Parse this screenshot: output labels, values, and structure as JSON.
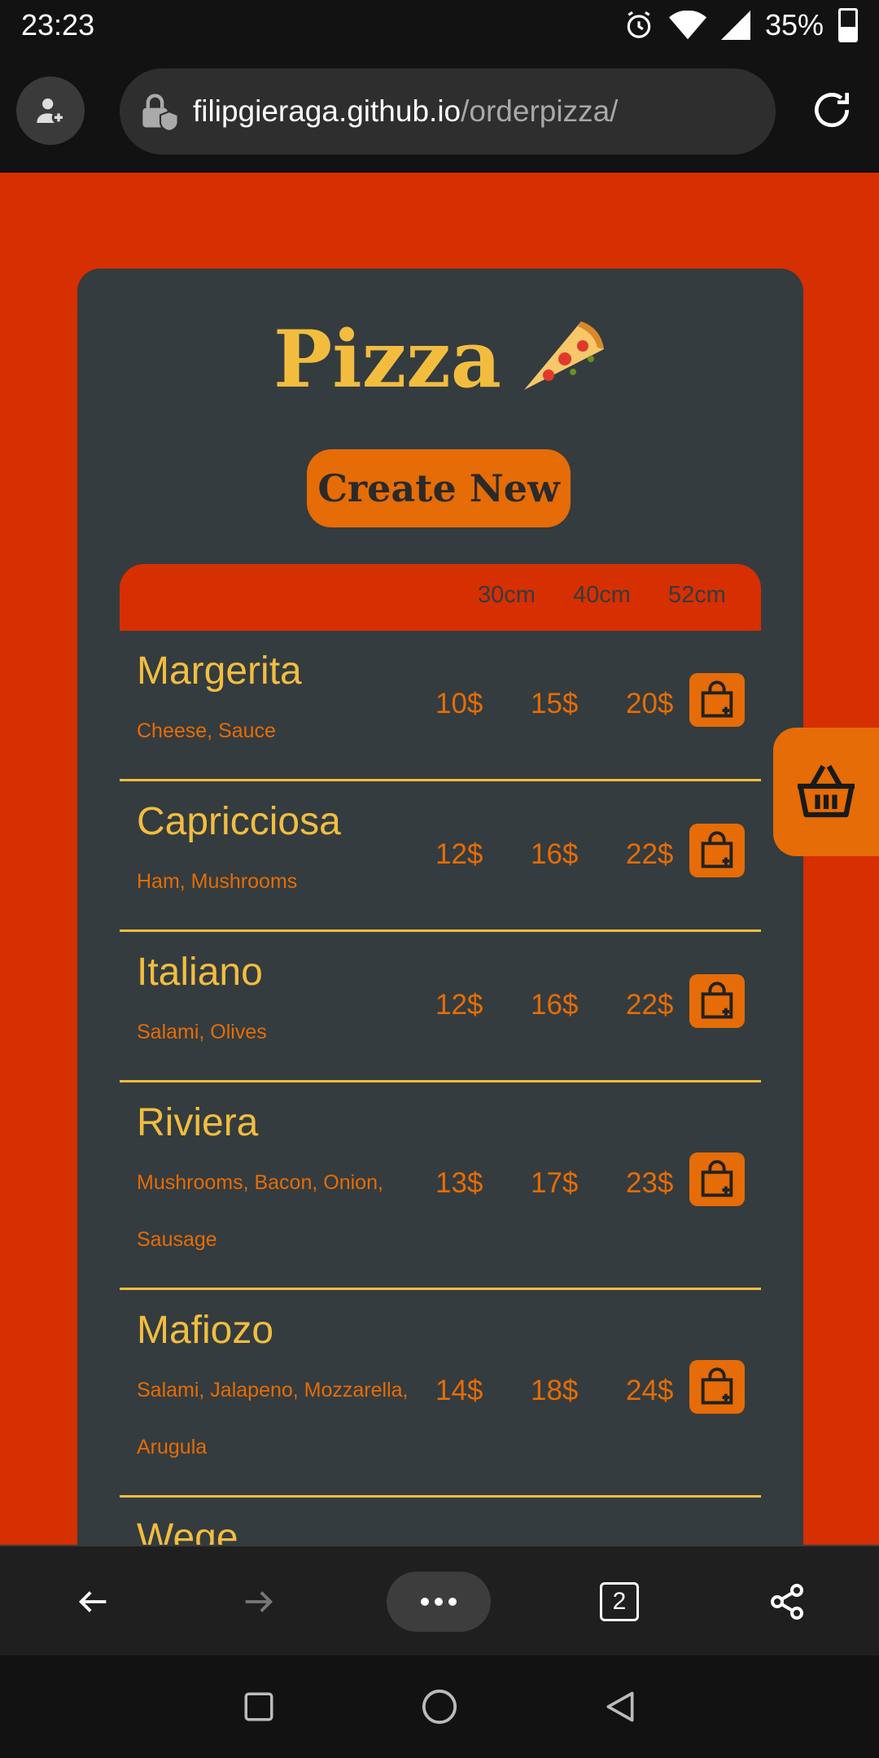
{
  "status_bar": {
    "time": "23:23",
    "battery": "35%"
  },
  "browser": {
    "url_host": "filipgieraga.github.io",
    "url_path": "/orderpizza/",
    "tab_count": "2"
  },
  "page": {
    "title": "Pizza",
    "create_button": "Create New",
    "table_headers": [
      "30cm",
      "40cm",
      "52cm"
    ],
    "pizzas": [
      {
        "name": "Margerita",
        "ingredients": "Cheese, Sauce",
        "prices": [
          "10$",
          "15$",
          "20$"
        ]
      },
      {
        "name": "Capricciosa",
        "ingredients": "Ham, Mushrooms",
        "prices": [
          "12$",
          "16$",
          "22$"
        ]
      },
      {
        "name": "Italiano",
        "ingredients": "Salami, Olives",
        "prices": [
          "12$",
          "16$",
          "22$"
        ]
      },
      {
        "name": "Riviera",
        "ingredients": "Mushrooms, Bacon, Onion, Sausage",
        "prices": [
          "13$",
          "17$",
          "23$"
        ]
      },
      {
        "name": "Mafiozo",
        "ingredients": "Salami, Jalapeno, Mozzarella, Arugula",
        "prices": [
          "14$",
          "18$",
          "24$"
        ]
      },
      {
        "name": "Wege",
        "ingredients": "",
        "prices": [
          "",
          "",
          ""
        ]
      }
    ]
  },
  "colors": {
    "background": "#d62f02",
    "card": "#343c3f",
    "accent_yellow": "#f2bd3f",
    "accent_orange": "#e56c06"
  }
}
